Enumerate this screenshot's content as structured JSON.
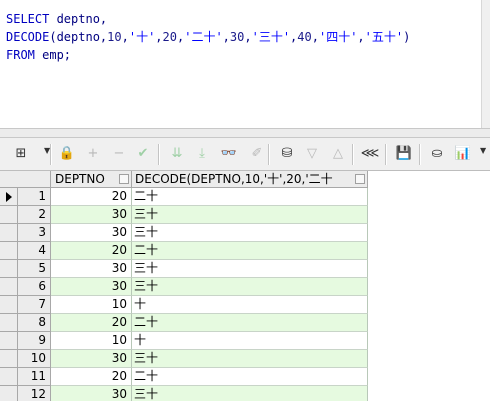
{
  "editor": {
    "lines": [
      [
        {
          "t": "SELECT",
          "c": "kw"
        },
        {
          "t": " deptno,",
          "c": ""
        }
      ],
      [
        {
          "t": "DECODE",
          "c": "kw"
        },
        {
          "t": "(deptno,",
          "c": ""
        },
        {
          "t": "10",
          "c": "num"
        },
        {
          "t": ",",
          "c": ""
        },
        {
          "t": "'十'",
          "c": "str"
        },
        {
          "t": ",",
          "c": ""
        },
        {
          "t": "20",
          "c": "num"
        },
        {
          "t": ",",
          "c": ""
        },
        {
          "t": "'二十'",
          "c": "str"
        },
        {
          "t": ",",
          "c": ""
        },
        {
          "t": "30",
          "c": "num"
        },
        {
          "t": ",",
          "c": ""
        },
        {
          "t": "'三十'",
          "c": "str"
        },
        {
          "t": ",",
          "c": ""
        },
        {
          "t": "40",
          "c": "num"
        },
        {
          "t": ",",
          "c": ""
        },
        {
          "t": "'四十'",
          "c": "str"
        },
        {
          "t": ",",
          "c": ""
        },
        {
          "t": "'五十'",
          "c": "str"
        },
        {
          "t": ")",
          "c": ""
        }
      ],
      [
        {
          "t": "FROM",
          "c": "kw"
        },
        {
          "t": " emp;",
          "c": ""
        }
      ]
    ]
  },
  "toolbar": {
    "icons": [
      {
        "name": "grid-options-icon",
        "glyph": "⊞",
        "state": "normal"
      },
      {
        "name": "lock-icon",
        "glyph": "🔒",
        "state": "normal"
      },
      {
        "name": "add-record-icon",
        "glyph": "+",
        "state": "dim"
      },
      {
        "name": "delete-record-icon",
        "glyph": "−",
        "state": "dim"
      },
      {
        "name": "post-changes-icon",
        "glyph": "✔",
        "state": "dimgreen"
      },
      {
        "name": "fetch-next-icon",
        "glyph": "⇊",
        "state": "dimgreen"
      },
      {
        "name": "fetch-last-icon",
        "glyph": "⤓",
        "state": "dimgreen"
      },
      {
        "name": "find-binoculars-icon",
        "glyph": "👓",
        "state": "normal"
      },
      {
        "name": "clear-eraser-icon",
        "glyph": "✐",
        "state": "dim"
      },
      {
        "name": "query-by-example-icon",
        "glyph": "⛁",
        "state": "normal"
      },
      {
        "name": "previous-icon",
        "glyph": "▽",
        "state": "dim"
      },
      {
        "name": "next-icon",
        "glyph": "△",
        "state": "dim"
      },
      {
        "name": "export-tree-icon",
        "glyph": "⋘",
        "state": "normal"
      },
      {
        "name": "save-icon",
        "glyph": "💾",
        "state": "normal"
      },
      {
        "name": "database-icon",
        "glyph": "⛀",
        "state": "normal"
      },
      {
        "name": "chart-icon",
        "glyph": "📊",
        "state": "normal"
      }
    ]
  },
  "grid": {
    "columns": [
      "DEPTNO",
      "DECODE(DEPTNO,10,'十',20,'二十"
    ],
    "current_row": 1,
    "rows": [
      {
        "n": "1",
        "deptno": "20",
        "decode": "二十"
      },
      {
        "n": "2",
        "deptno": "30",
        "decode": "三十"
      },
      {
        "n": "3",
        "deptno": "30",
        "decode": "三十"
      },
      {
        "n": "4",
        "deptno": "20",
        "decode": "二十"
      },
      {
        "n": "5",
        "deptno": "30",
        "decode": "三十"
      },
      {
        "n": "6",
        "deptno": "30",
        "decode": "三十"
      },
      {
        "n": "7",
        "deptno": "10",
        "decode": "十"
      },
      {
        "n": "8",
        "deptno": "20",
        "decode": "二十"
      },
      {
        "n": "9",
        "deptno": "10",
        "decode": "十"
      },
      {
        "n": "10",
        "deptno": "30",
        "decode": "三十"
      },
      {
        "n": "11",
        "deptno": "20",
        "decode": "二十"
      },
      {
        "n": "12",
        "deptno": "30",
        "decode": "三十"
      }
    ]
  },
  "colors": {
    "alt_row": "#e6fae0",
    "keyword": "#0000c0",
    "string": "#0000ff"
  }
}
